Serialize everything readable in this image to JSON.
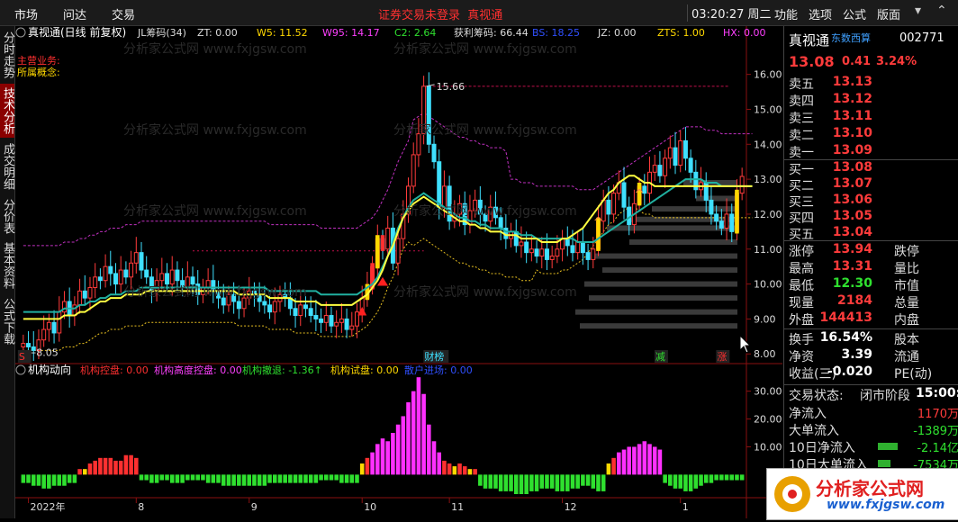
{
  "menu": [
    "市场",
    "问达",
    "交易"
  ],
  "notice": "证券交易未登录",
  "notice2": "真视通",
  "clock": "03:20:27 周二",
  "toolbar": [
    "功能",
    "选项",
    "公式",
    "版面"
  ],
  "window_buttons": [
    "▾",
    "⌃"
  ],
  "sidetabs": [
    "分时走势",
    "技术分析",
    "成交明细",
    "分价表",
    "基本资料",
    "公式下载"
  ],
  "chart_header": {
    "name": "真视通(日线 前复权)",
    "items": [
      {
        "label": "JL筹码(34)",
        "color": "#dddddd"
      },
      {
        "label": "ZT: 0.00",
        "color": "#dddddd"
      },
      {
        "label": "W5: 11.52",
        "color": "#ffd800"
      },
      {
        "label": "W95: 14.17",
        "color": "#ff40ff"
      },
      {
        "label": "C2: 2.64",
        "color": "#2fe02f"
      },
      {
        "label": "获利筹码: 66.44",
        "color": "#dddddd"
      },
      {
        "label": "BS: 18.25",
        "color": "#3050ff"
      },
      {
        "label": "JZ: 0.00",
        "color": "#dddddd"
      },
      {
        "label": "ZTS: 1.00",
        "color": "#ffd800"
      },
      {
        "label": "HX: 0.00",
        "color": "#ff40ff"
      }
    ],
    "line1": "主营业务:",
    "line2": "所属概念:",
    "watermark": "分析家公式网 www.fxjgsw.com"
  },
  "sub_header": {
    "name": "机构动向",
    "items": [
      {
        "label": "机构控盘: 0.00",
        "color": "#ff3030"
      },
      {
        "label": "机构高度控盘: 0.00",
        "color": "#ff40ff"
      },
      {
        "label": "机构撤退: -1.36↑",
        "color": "#2fe02f"
      },
      {
        "label": "机构试盘: 0.00",
        "color": "#ffd800"
      },
      {
        "label": "散户进场: 0.00",
        "color": "#3050ff"
      }
    ]
  },
  "chart_data": {
    "type": "candlestick",
    "y_axis": {
      "min": 7.8,
      "max": 16.3,
      "ticks": [
        8.0,
        9.0,
        10.0,
        11.0,
        12.0,
        13.0,
        14.0,
        15.0,
        16.0
      ]
    },
    "sub_y_axis": {
      "min": -7,
      "max": 37,
      "ticks": [
        10.0,
        20.0,
        30.0
      ]
    },
    "x_labels": [
      {
        "label": "2022年",
        "i": 1
      },
      {
        "label": "8",
        "i": 22
      },
      {
        "label": "9",
        "i": 44
      },
      {
        "label": "10",
        "i": 66
      },
      {
        "label": "11",
        "i": 83
      },
      {
        "label": "12",
        "i": 105
      },
      {
        "label": "1",
        "i": 128
      }
    ],
    "annotations": [
      {
        "text": "15.66",
        "type": "high"
      },
      {
        "text": "8.05",
        "type": "low"
      }
    ],
    "events": [
      {
        "text": "S",
        "i": 0,
        "color": "#ff3030"
      },
      {
        "text": "财榜",
        "i": 79,
        "color": "#3fe0ff"
      },
      {
        "text": "减",
        "i": 124,
        "color": "#2fe02f"
      },
      {
        "text": "涨",
        "i": 136,
        "color": "#ff3030"
      }
    ],
    "series": [
      {
        "name": "close",
        "values": [
          8.3,
          8.2,
          8.1,
          8.4,
          8.7,
          8.9,
          8.6,
          9.2,
          9.5,
          9.1,
          9.4,
          9.8,
          9.6,
          9.9,
          10.2,
          10.1,
          10.5,
          10.3,
          10.0,
          10.4,
          10.2,
          10.6,
          10.9,
          10.4,
          10.2,
          9.8,
          10.1,
          10.3,
          10.0,
          10.4,
          10.1,
          9.9,
          10.2,
          10.0,
          9.7,
          9.9,
          10.1,
          9.8,
          9.6,
          9.4,
          9.7,
          9.5,
          9.3,
          9.6,
          9.8,
          9.7,
          9.5,
          9.4,
          9.2,
          9.5,
          9.7,
          9.6,
          9.3,
          9.1,
          9.4,
          9.3,
          9.1,
          9.0,
          8.9,
          9.1,
          8.8,
          8.9,
          9.0,
          8.7,
          8.8,
          9.2,
          9.6,
          9.9,
          10.5,
          11.3,
          11.0,
          11.6,
          10.6,
          11.3,
          12.0,
          12.8,
          13.7,
          14.3,
          15.66,
          14.0,
          13.5,
          12.2,
          12.8,
          11.8,
          12.0,
          12.3,
          11.7,
          12.1,
          12.4,
          12.0,
          11.8,
          12.2,
          11.9,
          11.6,
          11.3,
          11.5,
          11.1,
          11.2,
          10.9,
          11.0,
          10.8,
          11.0,
          10.7,
          10.8,
          11.0,
          11.3,
          11.1,
          10.9,
          11.2,
          10.9,
          10.7,
          11.0,
          11.8,
          12.4,
          12.0,
          12.6,
          12.9,
          12.2,
          11.7,
          12.3,
          12.8,
          12.6,
          13.2,
          13.4,
          13.1,
          13.6,
          13.9,
          13.4,
          14.1,
          13.6,
          13.2,
          12.7,
          12.9,
          12.4,
          12.0,
          11.8,
          11.6,
          12.0,
          11.5,
          12.6,
          13.08
        ]
      },
      {
        "name": "ma_cyan",
        "values": [
          9.2,
          9.2,
          9.2,
          9.2,
          9.2,
          9.2,
          9.2,
          9.2,
          9.3,
          9.3,
          9.3,
          9.4,
          9.4,
          9.5,
          9.5,
          9.6,
          9.6,
          9.7,
          9.7,
          9.7,
          9.8,
          9.8,
          9.8,
          9.9,
          9.9,
          9.9,
          9.9,
          9.9,
          9.9,
          9.9,
          9.9,
          9.9,
          9.9,
          9.9,
          9.9,
          9.9,
          9.9,
          9.9,
          9.9,
          9.9,
          9.9,
          9.9,
          9.9,
          9.9,
          9.9,
          9.9,
          9.9,
          9.9,
          9.8,
          9.8,
          9.8,
          9.8,
          9.8,
          9.8,
          9.8,
          9.8,
          9.8,
          9.8,
          9.7,
          9.7,
          9.7,
          9.7,
          9.7,
          9.7,
          9.7,
          9.7,
          9.8,
          9.9,
          10.0,
          10.2,
          10.5,
          10.8,
          11.2,
          11.6,
          11.9,
          12.2,
          12.4,
          12.5,
          12.6,
          12.5,
          12.4,
          12.3,
          12.2,
          12.1,
          12.0,
          11.9,
          11.9,
          11.8,
          11.8,
          11.7,
          11.7,
          11.6,
          11.6,
          11.6,
          11.5,
          11.5,
          11.5,
          11.4,
          11.4,
          11.4,
          11.3,
          11.3,
          11.3,
          11.3,
          11.3,
          11.3,
          11.3,
          11.3,
          11.2,
          11.2,
          11.2,
          11.2,
          11.3,
          11.4,
          11.5,
          11.6,
          11.7,
          11.8,
          11.9,
          12.0,
          12.1,
          12.2,
          12.3,
          12.4,
          12.5,
          12.6,
          12.7,
          12.8,
          12.9,
          13.0,
          13.0,
          13.0,
          13.0,
          12.9,
          12.9,
          12.9,
          12.8,
          12.8,
          12.8,
          12.8,
          12.8,
          12.8,
          12.8
        ]
      },
      {
        "name": "ma_yellow",
        "values": [
          9.0,
          9.0,
          9.0,
          9.0,
          9.0,
          9.0,
          9.0,
          9.0,
          9.1,
          9.1,
          9.1,
          9.2,
          9.2,
          9.3,
          9.4,
          9.5,
          9.5,
          9.6,
          9.6,
          9.6,
          9.7,
          9.7,
          9.7,
          9.7,
          9.8,
          9.8,
          9.8,
          9.8,
          9.8,
          9.8,
          9.8,
          9.8,
          9.8,
          9.8,
          9.8,
          9.8,
          9.8,
          9.8,
          9.8,
          9.8,
          9.8,
          9.8,
          9.7,
          9.7,
          9.7,
          9.7,
          9.7,
          9.7,
          9.6,
          9.6,
          9.6,
          9.6,
          9.6,
          9.5,
          9.5,
          9.5,
          9.5,
          9.5,
          9.4,
          9.4,
          9.4,
          9.4,
          9.4,
          9.4,
          9.4,
          9.5,
          9.6,
          9.7,
          9.9,
          10.1,
          10.4,
          10.8,
          11.1,
          11.5,
          11.9,
          12.1,
          12.3,
          12.4,
          12.5,
          12.4,
          12.3,
          12.2,
          12.1,
          12.0,
          11.9,
          11.8,
          11.8,
          11.7,
          11.7,
          11.6,
          11.6,
          11.5,
          11.5,
          11.5,
          11.4,
          11.4,
          11.4,
          11.3,
          11.3,
          11.3,
          11.3,
          11.2,
          11.2,
          11.2,
          11.2,
          11.3,
          11.3,
          11.4,
          11.5,
          11.6,
          11.8,
          12.0,
          12.2,
          12.4,
          12.6,
          12.7,
          12.9,
          13.0,
          13.1,
          13.1,
          13.0,
          12.9,
          12.9,
          12.8,
          12.8,
          12.8,
          12.8,
          12.8,
          12.8,
          12.8,
          12.8,
          12.8,
          12.8,
          12.8,
          12.8,
          12.8,
          12.8,
          12.8,
          12.8,
          12.8,
          12.8,
          12.8,
          12.8
        ]
      },
      {
        "name": "sub_bars",
        "values": [
          -3,
          -3,
          -4,
          -4,
          -5,
          -5,
          -4,
          -4,
          -4,
          -3,
          -3,
          2,
          2,
          4,
          5,
          6,
          6,
          6,
          5,
          5,
          7,
          7,
          6,
          -2,
          -2,
          -3,
          -3,
          -2,
          -2,
          -3,
          -3,
          -3,
          -2,
          -2,
          -2,
          -2,
          -3,
          -3,
          -3,
          -4,
          -4,
          -4,
          -4,
          -4,
          -4,
          -4,
          -4,
          -4,
          -3,
          -3,
          -3,
          -3,
          -3,
          -3,
          -3,
          -3,
          -3,
          -3,
          -2,
          -2,
          -2,
          -2,
          -3,
          -3,
          -3,
          -3,
          4,
          6,
          8,
          11,
          13,
          12,
          15,
          18,
          21,
          26,
          30,
          35,
          29,
          18,
          12,
          8,
          5,
          4,
          3,
          4,
          3,
          2,
          2,
          -4,
          -5,
          -5,
          -5,
          -6,
          -6,
          -6,
          -7,
          -7,
          -7,
          -6,
          -6,
          -5,
          -5,
          -5,
          -6,
          -6,
          -6,
          -5,
          -5,
          -4,
          -4,
          -5,
          -6,
          -6,
          4,
          6,
          8,
          9,
          10,
          10,
          11,
          12,
          11,
          10,
          9,
          -3,
          -4,
          -5,
          -5,
          -6,
          -6,
          -5,
          -4,
          -3,
          -3,
          -2,
          -2,
          -2,
          -2,
          -2,
          -2
        ]
      }
    ]
  },
  "quote": {
    "name": "真视通",
    "tag": "东数西算",
    "code": "002771",
    "price": "13.08",
    "change": "0.41",
    "pct": "3.24%",
    "asks": [
      {
        "label": "卖五",
        "price": "13.13"
      },
      {
        "label": "卖四",
        "price": "13.12"
      },
      {
        "label": "卖三",
        "price": "13.11"
      },
      {
        "label": "卖二",
        "price": "13.10"
      },
      {
        "label": "卖一",
        "price": "13.09"
      }
    ],
    "bids": [
      {
        "label": "买一",
        "price": "13.08"
      },
      {
        "label": "买二",
        "price": "13.07"
      },
      {
        "label": "买三",
        "price": "13.06"
      },
      {
        "label": "买四",
        "price": "13.05"
      },
      {
        "label": "买五",
        "price": "13.04"
      }
    ],
    "stats": [
      {
        "l": "涨停",
        "v": "13.94",
        "vc": "red",
        "r": "跌停"
      },
      {
        "l": "最高",
        "v": "13.31",
        "vc": "red",
        "r": "量比"
      },
      {
        "l": "最低",
        "v": "12.30",
        "vc": "green",
        "r": "市值"
      },
      {
        "l": "现量",
        "v": "2184",
        "vc": "red",
        "r": "总量"
      },
      {
        "l": "外盘",
        "v": "144413",
        "vc": "red",
        "r": "内盘"
      }
    ],
    "stats2": [
      {
        "l": "换手",
        "v": "16.54%",
        "vc": "white",
        "r": "股本"
      },
      {
        "l": "净资",
        "v": "3.39",
        "vc": "white",
        "r": "流通"
      },
      {
        "l": "收益(三)",
        "v": "-0.020",
        "vc": "white",
        "r": "PE(动)"
      }
    ],
    "status_label": "交易状态:",
    "status_value": "闭市阶段",
    "status_time": "15:00:0",
    "flows": [
      {
        "l": "净流入",
        "v": "1170万",
        "vc": "red",
        "bar": 0
      },
      {
        "l": "大单流入",
        "v": "-1389万",
        "vc": "green",
        "bar": 0
      },
      {
        "l": "10日净流入",
        "v": "-2.14亿",
        "vc": "green",
        "bar": 22
      },
      {
        "l": "10日大单流入",
        "v": "-7534万",
        "vc": "green",
        "bar": 14
      }
    ],
    "logo_text": "分析家公式网",
    "logo_url": "www.fxjgsw.com"
  }
}
